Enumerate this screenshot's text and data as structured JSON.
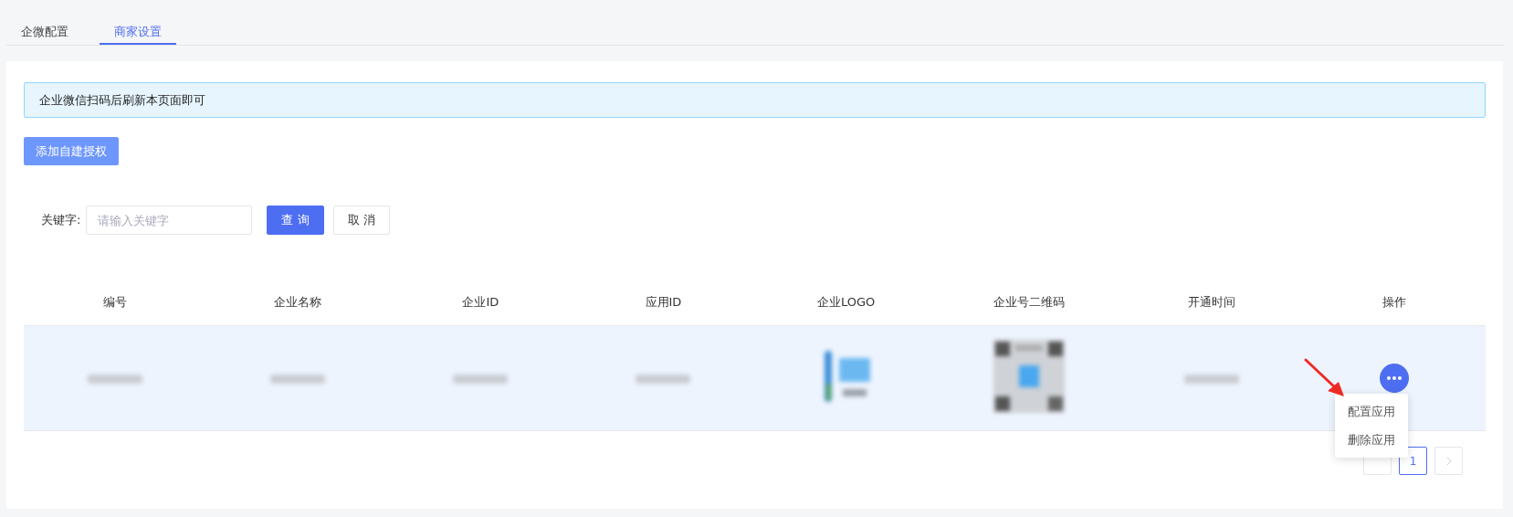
{
  "tabs": [
    {
      "label": "企微配置",
      "selected": false
    },
    {
      "label": "商家设置",
      "selected": true
    }
  ],
  "alert": "企业微信扫码后刷新本页面即可",
  "add_button": "添加自建授权",
  "search": {
    "label": "关键字:",
    "placeholder": "请输入关键字",
    "buttons": [
      {
        "label": "查 询",
        "kind": "primary"
      },
      {
        "label": "取 消",
        "kind": "default"
      }
    ]
  },
  "table": {
    "columns": [
      "编号",
      "企业名称",
      "企业ID",
      "应用ID",
      "企业LOGO",
      "企业号二维码",
      "开通时间",
      "操作"
    ],
    "rows": [
      {
        "highlighted": true,
        "cells": [
          {
            "kind": "blurred"
          },
          {
            "kind": "blurred"
          },
          {
            "kind": "blurred"
          },
          {
            "kind": "blurred"
          },
          {
            "kind": "logo"
          },
          {
            "kind": "qr"
          },
          {
            "kind": "blurred"
          },
          {
            "kind": "actions"
          }
        ]
      }
    ]
  },
  "action_menu": [
    "配置应用",
    "删除应用"
  ],
  "pagination": {
    "pages": [
      {
        "label": "1",
        "selected": true
      }
    ]
  }
}
